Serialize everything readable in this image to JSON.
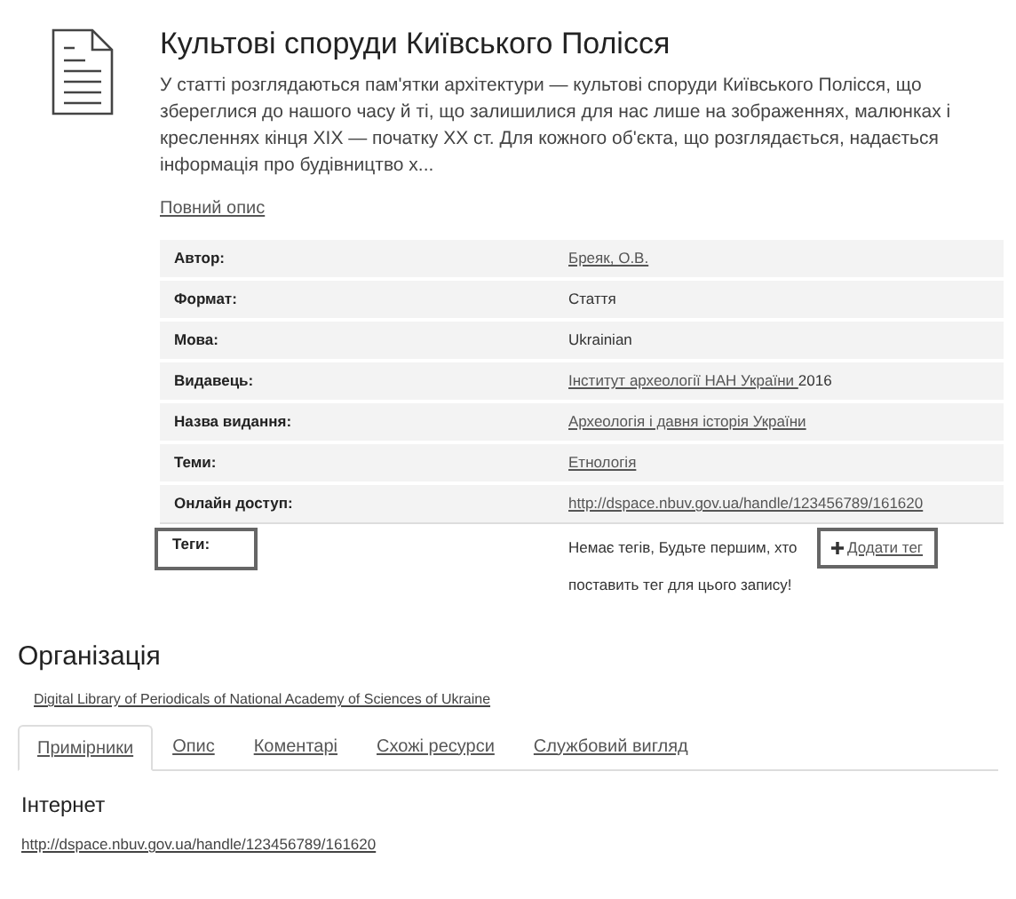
{
  "record": {
    "title": "Культові споруди Київського Полісся",
    "summary": "У статті розглядаються пам'ятки архітектури — культові споруди Київського Полісся, що збереглися до нашого часу й ті, що залишилися для нас лише на зображеннях, малюнках і кресленнях кінця XIX — початку XX ст. Для кожного об'єкта, що розглядається, надається інформація про будівництво х...",
    "full_description_link": "Повний опис"
  },
  "details": [
    {
      "label": "Автор:",
      "value": "Бреяк, О.В.",
      "link": true
    },
    {
      "label": "Формат:",
      "value": "Стаття",
      "link": false
    },
    {
      "label": "Мова:",
      "value": "Ukrainian",
      "link": false
    },
    {
      "label": "Видавець:",
      "value": "Інститут археології НАН України ",
      "link": true,
      "suffix": "2016"
    },
    {
      "label": "Назва видання:",
      "value": "Археологія і давня історія України",
      "link": true
    },
    {
      "label": "Теми:",
      "value": "Етнологія",
      "link": true
    },
    {
      "label": "Онлайн доступ:",
      "value": "http://dspace.nbuv.gov.ua/handle/123456789/161620",
      "link": true
    }
  ],
  "tags": {
    "label": "Теги:",
    "message": "Немає тегів, Будьте першим, хто поставить тег для цього запису!",
    "add_button": "Додати тег"
  },
  "organization": {
    "heading": "Організація",
    "link": "Digital Library of Periodicals of National Academy of Sciences of Ukraine"
  },
  "tabs": [
    {
      "label": "Примірники",
      "selected": true
    },
    {
      "label": "Опис",
      "selected": false
    },
    {
      "label": "Коментарі",
      "selected": false
    },
    {
      "label": "Схожі ресурси",
      "selected": false
    },
    {
      "label": "Службовий вигляд",
      "selected": false
    }
  ],
  "holdings": {
    "heading": "Інтернет",
    "link": "http://dspace.nbuv.gov.ua/handle/123456789/161620"
  }
}
